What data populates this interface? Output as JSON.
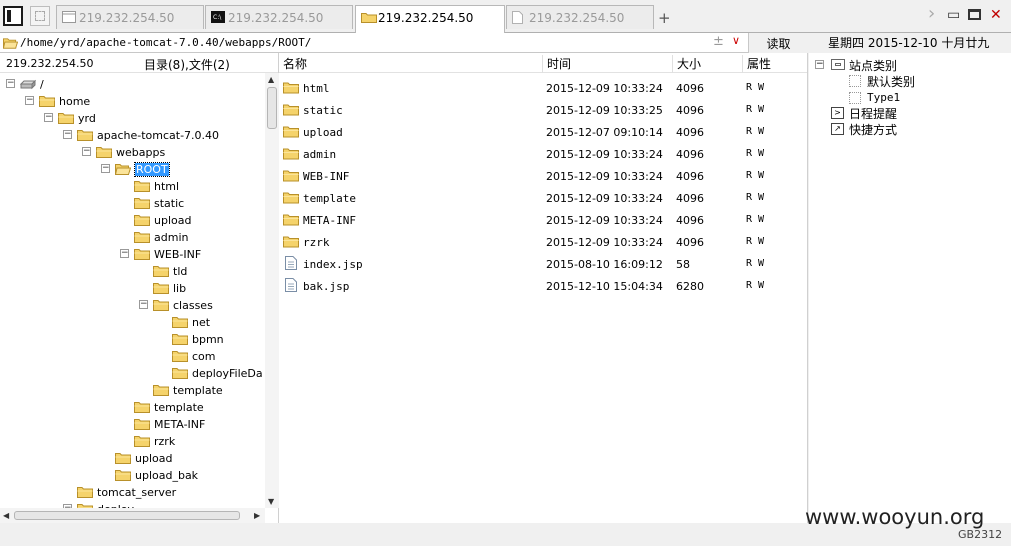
{
  "tabs": [
    {
      "label": "219.232.254.50",
      "type": "file",
      "active": false
    },
    {
      "label": "219.232.254.50",
      "type": "terminal",
      "active": false
    },
    {
      "label": "219.232.254.50",
      "type": "folder",
      "active": true
    },
    {
      "label": "219.232.254.50",
      "type": "document",
      "active": false
    }
  ],
  "tab_add": "+",
  "window_controls": {
    "chevron": "›",
    "minimize": "▭",
    "maximize": "□",
    "close": "✕"
  },
  "address": {
    "path": "/home/yrd/apache-tomcat-7.0.40/webapps/ROOT/",
    "plus": "±",
    "dropdown": "∨",
    "read_button": "读取"
  },
  "date_text": "星期四 2015-12-10 十月廿九",
  "left_panel": {
    "ip": "219.232.254.50",
    "count": "目录(8),文件(2)"
  },
  "tree": [
    {
      "label": "/",
      "depth": 0,
      "expander": "−",
      "icon": "drive"
    },
    {
      "label": "home",
      "depth": 1,
      "expander": "−",
      "icon": "folder"
    },
    {
      "label": "yrd",
      "depth": 2,
      "expander": "−",
      "icon": "folder"
    },
    {
      "label": "apache-tomcat-7.0.40",
      "depth": 3,
      "expander": "−",
      "icon": "folder"
    },
    {
      "label": "webapps",
      "depth": 4,
      "expander": "−",
      "icon": "folder"
    },
    {
      "label": "ROOT",
      "depth": 5,
      "expander": "−",
      "icon": "folder-open",
      "selected": true
    },
    {
      "label": "html",
      "depth": 6,
      "expander": "",
      "icon": "folder"
    },
    {
      "label": "static",
      "depth": 6,
      "expander": "",
      "icon": "folder"
    },
    {
      "label": "upload",
      "depth": 6,
      "expander": "",
      "icon": "folder"
    },
    {
      "label": "admin",
      "depth": 6,
      "expander": "",
      "icon": "folder"
    },
    {
      "label": "WEB-INF",
      "depth": 6,
      "expander": "−",
      "icon": "folder"
    },
    {
      "label": "tld",
      "depth": 7,
      "expander": "",
      "icon": "folder"
    },
    {
      "label": "lib",
      "depth": 7,
      "expander": "",
      "icon": "folder"
    },
    {
      "label": "classes",
      "depth": 7,
      "expander": "−",
      "icon": "folder"
    },
    {
      "label": "net",
      "depth": 8,
      "expander": "",
      "icon": "folder"
    },
    {
      "label": "bpmn",
      "depth": 8,
      "expander": "",
      "icon": "folder"
    },
    {
      "label": "com",
      "depth": 8,
      "expander": "",
      "icon": "folder"
    },
    {
      "label": "deployFileDa",
      "depth": 8,
      "expander": "",
      "icon": "folder"
    },
    {
      "label": "template",
      "depth": 7,
      "expander": "",
      "icon": "folder"
    },
    {
      "label": "template",
      "depth": 6,
      "expander": "",
      "icon": "folder"
    },
    {
      "label": "META-INF",
      "depth": 6,
      "expander": "",
      "icon": "folder"
    },
    {
      "label": "rzrk",
      "depth": 6,
      "expander": "",
      "icon": "folder"
    },
    {
      "label": "upload",
      "depth": 5,
      "expander": "",
      "icon": "folder"
    },
    {
      "label": "upload_bak",
      "depth": 5,
      "expander": "",
      "icon": "folder"
    },
    {
      "label": "tomcat_server",
      "depth": 3,
      "expander": "",
      "icon": "folder"
    },
    {
      "label": "deploy",
      "depth": 3,
      "expander": "−",
      "icon": "folder"
    }
  ],
  "file_columns": {
    "name": "名称",
    "time": "时间",
    "size": "大小",
    "attr": "属性"
  },
  "files": [
    {
      "name": "html",
      "time": "2015-12-09 10:33:24",
      "size": "4096",
      "attr": "R W",
      "icon": "folder"
    },
    {
      "name": "static",
      "time": "2015-12-09 10:33:25",
      "size": "4096",
      "attr": "R W",
      "icon": "folder"
    },
    {
      "name": "upload",
      "time": "2015-12-07 09:10:14",
      "size": "4096",
      "attr": "R W",
      "icon": "folder"
    },
    {
      "name": "admin",
      "time": "2015-12-09 10:33:24",
      "size": "4096",
      "attr": "R W",
      "icon": "folder"
    },
    {
      "name": "WEB-INF",
      "time": "2015-12-09 10:33:24",
      "size": "4096",
      "attr": "R W",
      "icon": "folder"
    },
    {
      "name": "template",
      "time": "2015-12-09 10:33:24",
      "size": "4096",
      "attr": "R W",
      "icon": "folder"
    },
    {
      "name": "META-INF",
      "time": "2015-12-09 10:33:24",
      "size": "4096",
      "attr": "R W",
      "icon": "folder"
    },
    {
      "name": "rzrk",
      "time": "2015-12-09 10:33:24",
      "size": "4096",
      "attr": "R W",
      "icon": "folder"
    },
    {
      "name": "index.jsp",
      "time": "2015-08-10 16:09:12",
      "size": "58",
      "attr": "R W",
      "icon": "file"
    },
    {
      "name": "bak.jsp",
      "time": "2015-12-10 15:04:34",
      "size": "6280",
      "attr": "R W",
      "icon": "file"
    }
  ],
  "right_panel": {
    "site_category": "站点类别",
    "site_children": [
      "默认类别",
      "Type1"
    ],
    "schedule": "日程提醒",
    "shortcuts": "快捷方式"
  },
  "watermark": "www.wooyun.org",
  "encoding": "GB2312",
  "colors": {
    "selection": "#3399ff",
    "folder": "#f5d36b",
    "close": "#c00000"
  }
}
